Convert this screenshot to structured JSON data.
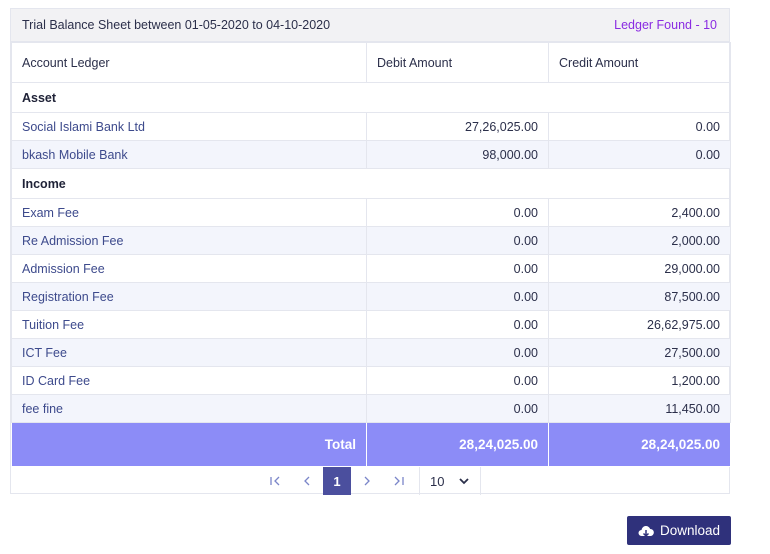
{
  "header": {
    "title": "Trial Balance Sheet between 01-05-2020 to 04-10-2020",
    "ledger_found": "Ledger Found - 10"
  },
  "columns": [
    "Account Ledger",
    "Debit Amount",
    "Credit Amount"
  ],
  "groups": [
    {
      "name": "Asset",
      "rows": [
        {
          "ledger": "Social Islami Bank Ltd",
          "debit": "27,26,025.00",
          "credit": "0.00"
        },
        {
          "ledger": "bkash Mobile Bank",
          "debit": "98,000.00",
          "credit": "0.00"
        }
      ]
    },
    {
      "name": "Income",
      "rows": [
        {
          "ledger": "Exam Fee",
          "debit": "0.00",
          "credit": "2,400.00"
        },
        {
          "ledger": "Re Admission Fee",
          "debit": "0.00",
          "credit": "2,000.00"
        },
        {
          "ledger": "Admission Fee",
          "debit": "0.00",
          "credit": "29,000.00"
        },
        {
          "ledger": "Registration Fee",
          "debit": "0.00",
          "credit": "87,500.00"
        },
        {
          "ledger": "Tuition Fee",
          "debit": "0.00",
          "credit": "26,62,975.00"
        },
        {
          "ledger": "ICT Fee",
          "debit": "0.00",
          "credit": "27,500.00"
        },
        {
          "ledger": "ID Card Fee",
          "debit": "0.00",
          "credit": "1,200.00"
        },
        {
          "ledger": "fee fine",
          "debit": "0.00",
          "credit": "11,450.00"
        }
      ]
    }
  ],
  "total": {
    "label": "Total",
    "debit": "28,24,025.00",
    "credit": "28,24,025.00"
  },
  "pagination": {
    "first_icon": "first-page-icon",
    "prev_icon": "prev-page-icon",
    "current_page": "1",
    "next_icon": "next-page-icon",
    "last_icon": "last-page-icon",
    "page_size": "10"
  },
  "download": {
    "label": "Download",
    "icon": "cloud-download-icon"
  },
  "colors": {
    "accent": "#2f317b",
    "total_bg": "#8c8cf7",
    "ledger_found": "#8a2be2",
    "active_page": "#4b4f9e"
  }
}
